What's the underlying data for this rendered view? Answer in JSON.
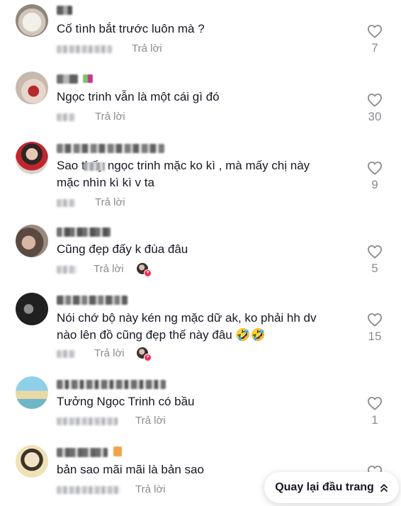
{
  "comments": [
    {
      "text": "Cố tình bắt trước luôn mà ?",
      "reply": "Trả lời",
      "likes": "7",
      "creator_liked": false
    },
    {
      "text": "Ngọc trinh vẫn là một cái gì đó",
      "reply": "Trả lời",
      "likes": "30",
      "creator_liked": false
    },
    {
      "text": "Sao      thấy ngọc trinh mặc ko kì , mà mấy chị này\nmặc nhìn kì kì v ta",
      "reply": "Trả lời",
      "likes": "9",
      "creator_liked": false
    },
    {
      "text": "Cũng đẹp đấy k đùa đâu",
      "reply": "Trả lời",
      "likes": "5",
      "creator_liked": true
    },
    {
      "text": "Nói chớ bộ này kén ng mặc dữ ak, ko phải hh dv\nnào lên đồ cũng đẹp thế này đâu 🤣🤣",
      "reply": "Trả lời",
      "likes": "15",
      "creator_liked": true
    },
    {
      "text": "Tưởng Ngọc Trinh có bầu",
      "reply": "Trả lời",
      "likes": "1",
      "creator_liked": false
    },
    {
      "text": "bản sao mãi mãi là bản sao",
      "reply": "Trả lời",
      "likes": "",
      "creator_liked": false
    }
  ],
  "back_to_top": {
    "label": "Quay lại đầu trang",
    "icon": "double-chevron-up-icon"
  },
  "colors": {
    "text": "#161823",
    "muted": "#8a8b91",
    "accent": "#fe2c55"
  }
}
